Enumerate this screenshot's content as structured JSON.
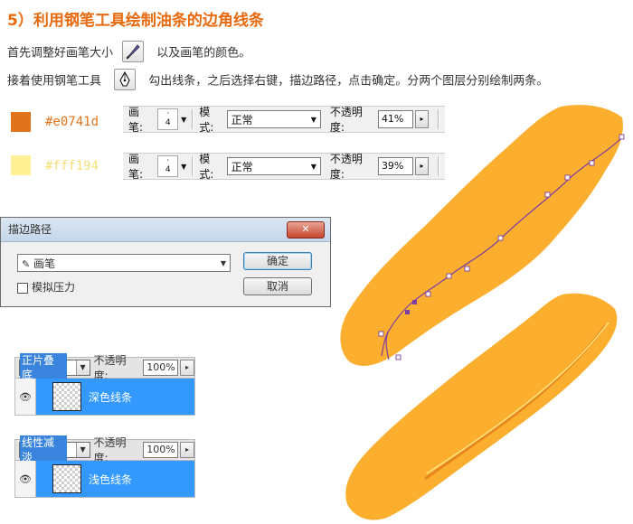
{
  "heading": "5）利用钢笔工具绘制油条的边角线条",
  "line1": {
    "before": "首先调整好画笔大小",
    "after": "以及画笔的颜色。"
  },
  "line2": {
    "before": "接着使用钢笔工具",
    "after": "勾出线条，之后选择右键，描边路径，点击确定。分两个图层分别绘制两条。"
  },
  "colors": {
    "dark_hex": "#e0741d",
    "light_hex": "#fff194",
    "dark_label": "#e0741d",
    "light_label": "#fff194",
    "accent": "#e86a0e",
    "selection": "#3399ff",
    "bread": "#fcae2e"
  },
  "options_bar_1": {
    "brush_label": "画笔:",
    "brush_size": "4",
    "mode_label": "模式:",
    "mode_value": "正常",
    "opacity_label": "不透明度:",
    "opacity_value": "41%"
  },
  "options_bar_2": {
    "brush_label": "画笔:",
    "brush_size": "4",
    "mode_label": "模式:",
    "mode_value": "正常",
    "opacity_label": "不透明度:",
    "opacity_value": "39%"
  },
  "dialog": {
    "title": "描边路径",
    "tool_value": "画笔",
    "simulate_pressure": "模拟压力",
    "ok": "确定",
    "cancel": "取消"
  },
  "layers_1": {
    "blend_mode": "正片叠底",
    "opacity_label": "不透明度:",
    "opacity_value": "100%",
    "layer_name": "深色线条"
  },
  "layers_2": {
    "blend_mode": "线性减淡",
    "opacity_label": "不透明度:",
    "opacity_value": "100%",
    "layer_name": "浅色线条"
  },
  "icons": {
    "brush": "brush-icon",
    "pen": "pen-tool-icon",
    "eye": "eye-icon",
    "close": "close-icon",
    "dropdown": "chevron-down-icon"
  }
}
